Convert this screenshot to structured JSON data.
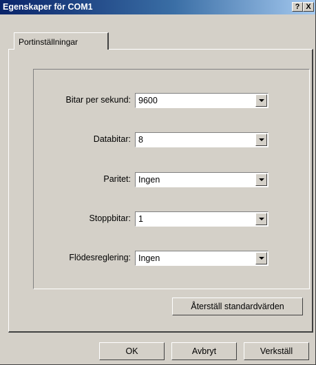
{
  "window": {
    "title": "Egenskaper för COM1"
  },
  "titlebar": {
    "help_label": "?",
    "close_label": "X"
  },
  "tabs": [
    {
      "label": "Portinställningar"
    }
  ],
  "fields": [
    {
      "label": "Bitar per sekund:",
      "value": "9600"
    },
    {
      "label": "Databitar:",
      "value": "8"
    },
    {
      "label": "Paritet:",
      "value": "Ingen"
    },
    {
      "label": "Stoppbitar:",
      "value": "1"
    },
    {
      "label": "Flödesreglering:",
      "value": "Ingen"
    }
  ],
  "restore_button": {
    "label": "Återställ standardvärden"
  },
  "footer": {
    "ok_label": "OK",
    "cancel_label": "Avbryt",
    "apply_label": "Verkställ"
  }
}
